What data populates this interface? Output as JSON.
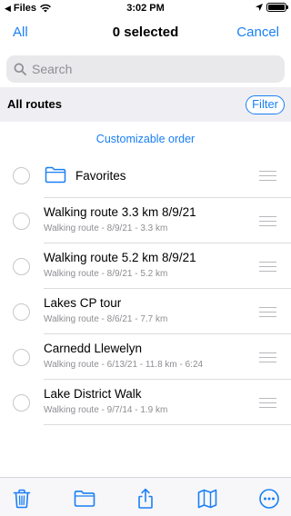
{
  "status_bar": {
    "back_app": "Files",
    "time": "3:02 PM"
  },
  "nav": {
    "left": "All",
    "title": "0 selected",
    "right": "Cancel"
  },
  "search": {
    "placeholder": "Search"
  },
  "section": {
    "title": "All routes",
    "filter": "Filter"
  },
  "custom_order": "Customizable order",
  "folder": {
    "label": "Favorites",
    "icon": "folder-icon"
  },
  "routes": [
    {
      "title": "Walking route 3.3 km 8/9/21",
      "subtitle": "Walking route - 8/9/21 - 3.3 km"
    },
    {
      "title": "Walking route 5.2 km 8/9/21",
      "subtitle": "Walking route - 8/9/21 - 5.2 km"
    },
    {
      "title": "Lakes CP tour",
      "subtitle": "Walking route - 8/6/21 - 7.7 km"
    },
    {
      "title": "Carnedd Llewelyn",
      "subtitle": "Walking route - 6/13/21 - 11.8 km - 6:24"
    },
    {
      "title": "Lake District Walk",
      "subtitle": "Walking route - 9/7/14 - 1.9 km"
    }
  ],
  "toolbar": [
    "trash-icon",
    "folder-icon",
    "share-icon",
    "map-icon",
    "more-icon"
  ],
  "colors": {
    "accent": "#1a7ff5",
    "section_bg": "#efeff3",
    "secondary_text": "#8e8e93"
  }
}
